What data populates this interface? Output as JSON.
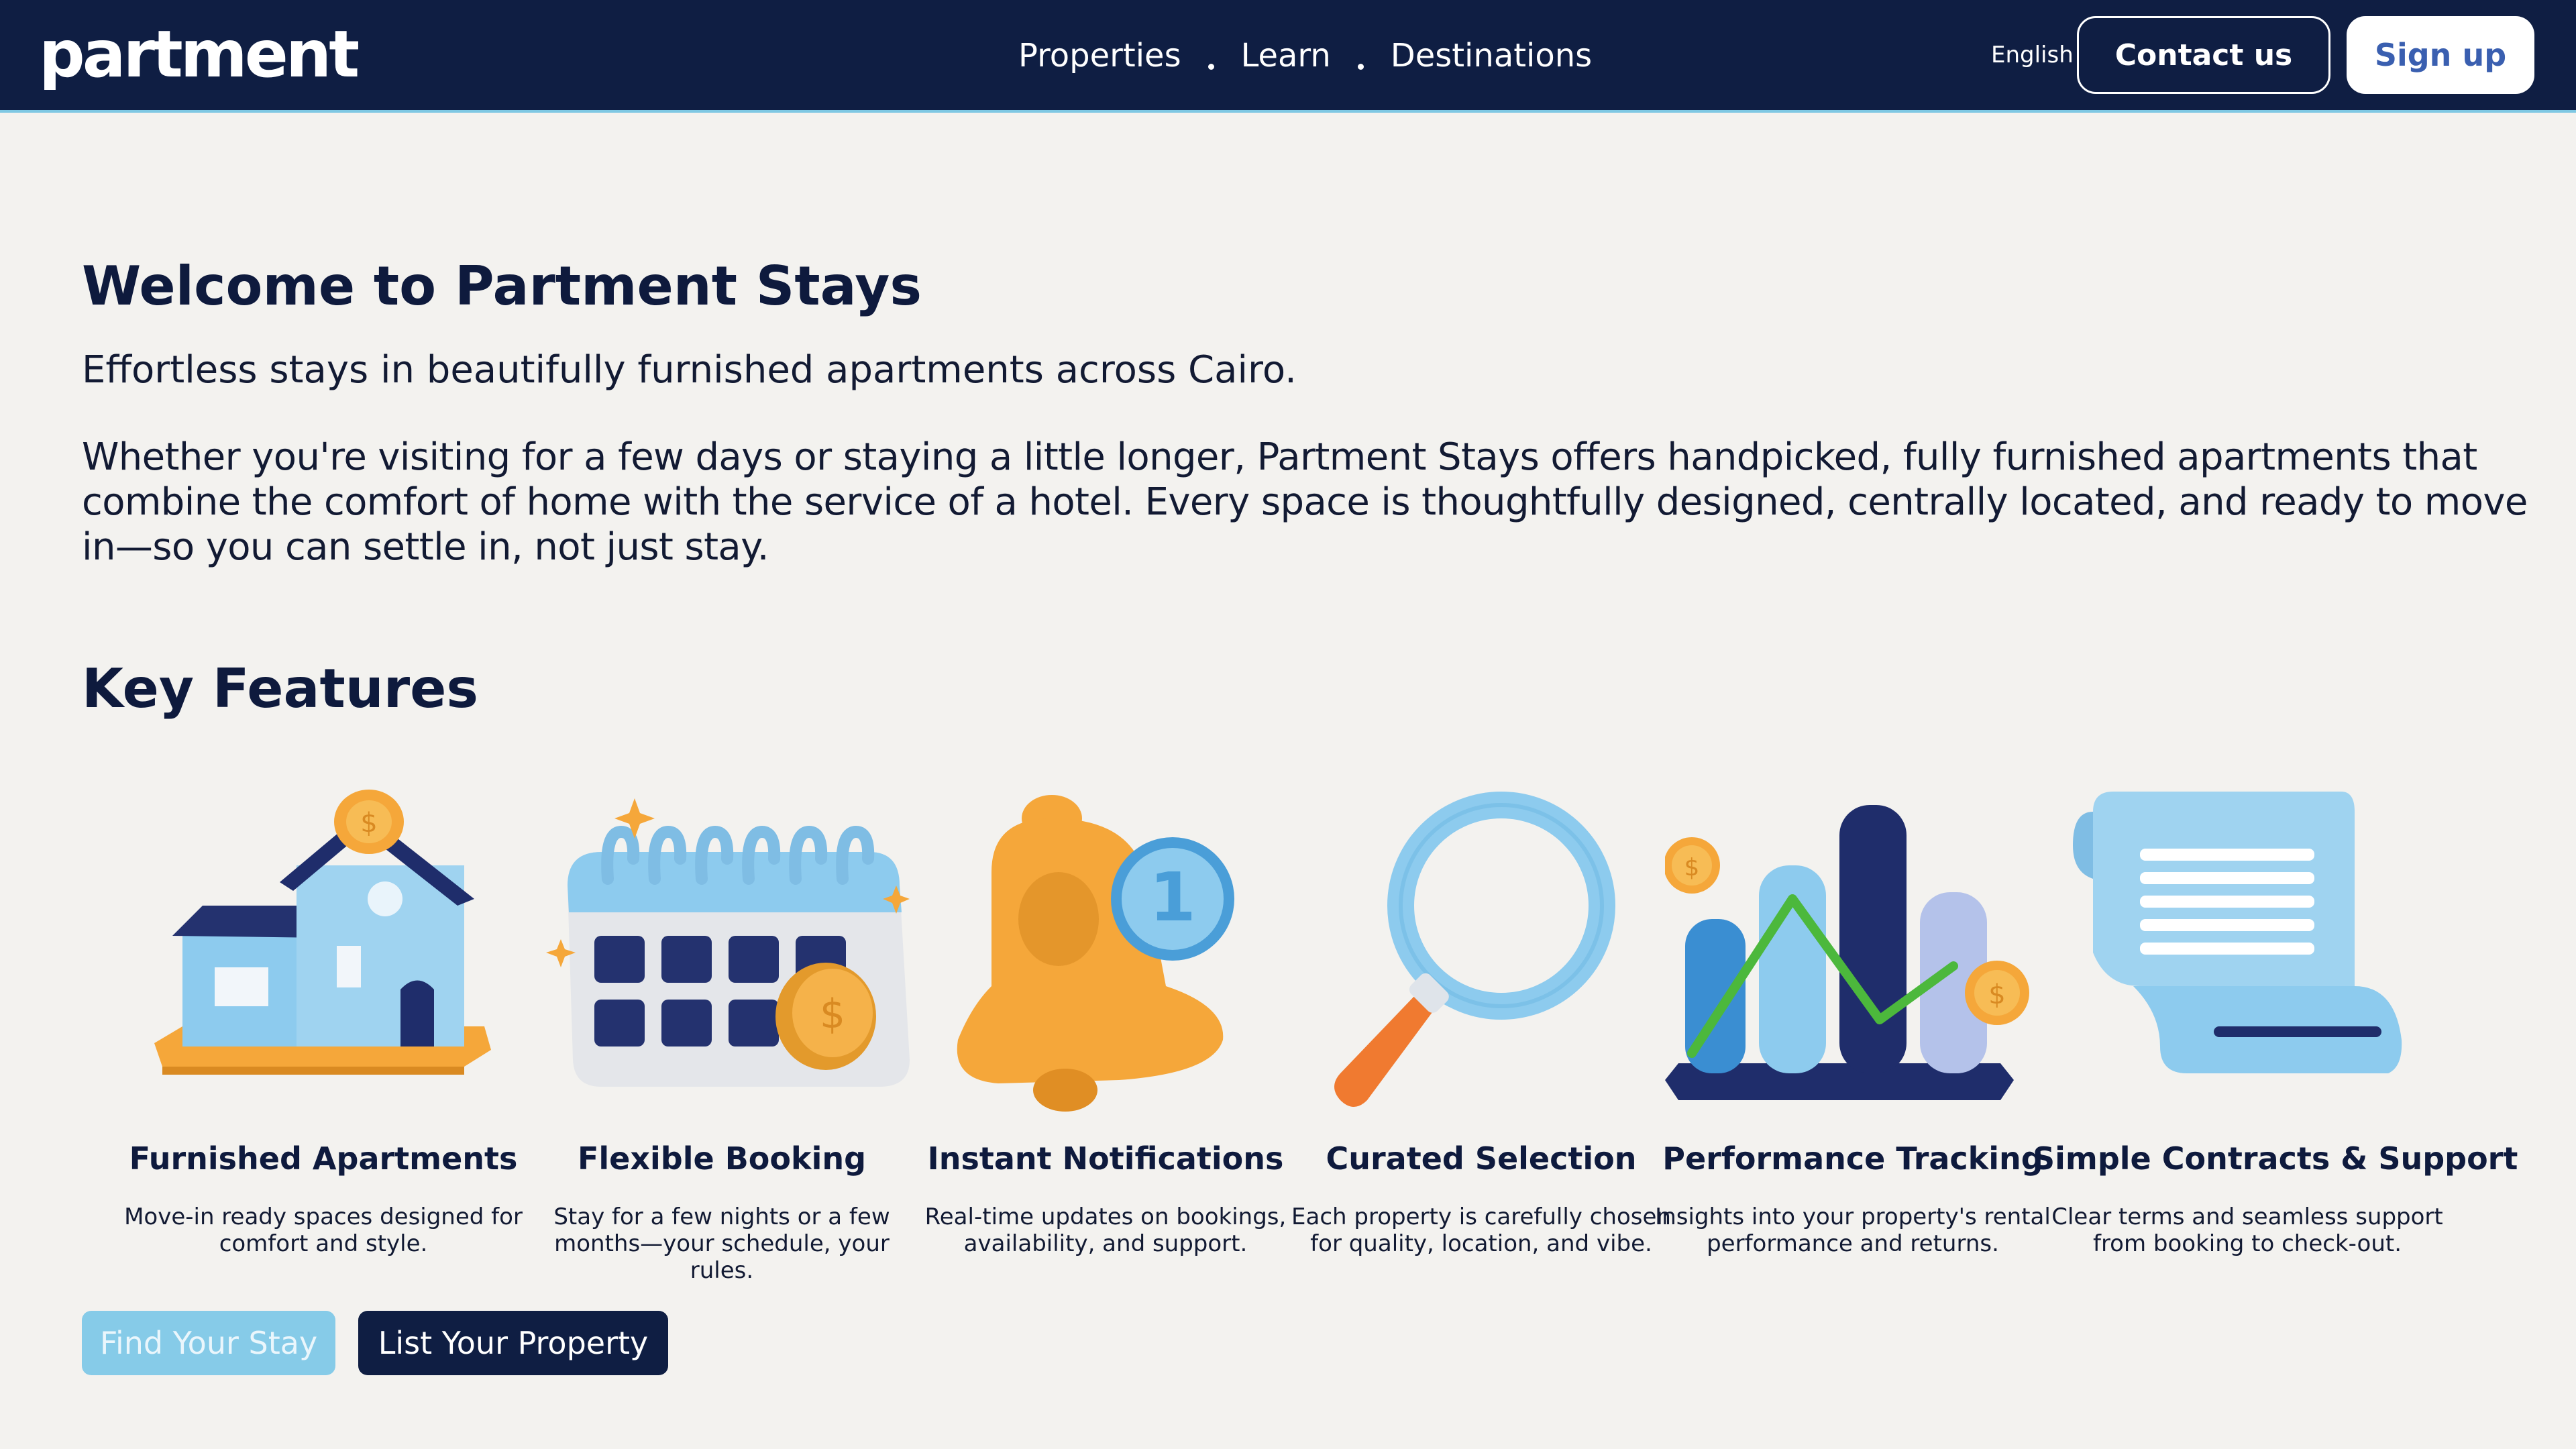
{
  "header": {
    "logo": "partment",
    "nav": [
      {
        "label": "Properties"
      },
      {
        "label": "Learn"
      },
      {
        "label": "Destinations"
      }
    ],
    "language": "English",
    "contact_label": "Contact us",
    "signup_label": "Sign up"
  },
  "hero": {
    "title": "Welcome to Partment Stays",
    "subtitle": "Effortless stays in beautifully furnished apartments across Cairo.",
    "paragraph": "Whether you're visiting for a few days or staying a little longer, Partment Stays offers handpicked, fully furnished apartments that combine the comfort of home with the service of a hotel. Every space is thoughtfully designed, centrally located, and ready to move in—so you can settle in, not just stay."
  },
  "features": {
    "title": "Key Features",
    "items": [
      {
        "icon": "house-icon",
        "title": "Furnished Apartments",
        "desc": "Move-in ready spaces designed for comfort and style."
      },
      {
        "icon": "calendar-icon",
        "title": "Flexible Booking",
        "desc": "Stay for a few nights or a few months—your schedule, your rules."
      },
      {
        "icon": "bell-icon",
        "title": "Instant Notifications",
        "desc": "Real-time updates on bookings, availability, and support.",
        "badge": "1"
      },
      {
        "icon": "magnifier-icon",
        "title": "Curated Selection",
        "desc": "Each property is carefully chosen for quality, location, and vibe."
      },
      {
        "icon": "bar-chart-icon",
        "title": "Performance Tracking",
        "desc": "Insights into your property's rental performance and returns."
      },
      {
        "icon": "contract-scroll-icon",
        "title": "Simple Contracts & Support",
        "desc": "Clear terms and seamless support from booking to check-out."
      }
    ]
  },
  "cta": {
    "find_label": "Find Your Stay",
    "list_label": "List Your Property"
  },
  "colors": {
    "header_bg": "#0f1e43",
    "page_bg": "#f3f2ef",
    "accent_light_blue": "#86cbe8",
    "signup_text": "#3a5fb0",
    "orange": "#f5a73a",
    "navy": "#1f2d6b"
  }
}
